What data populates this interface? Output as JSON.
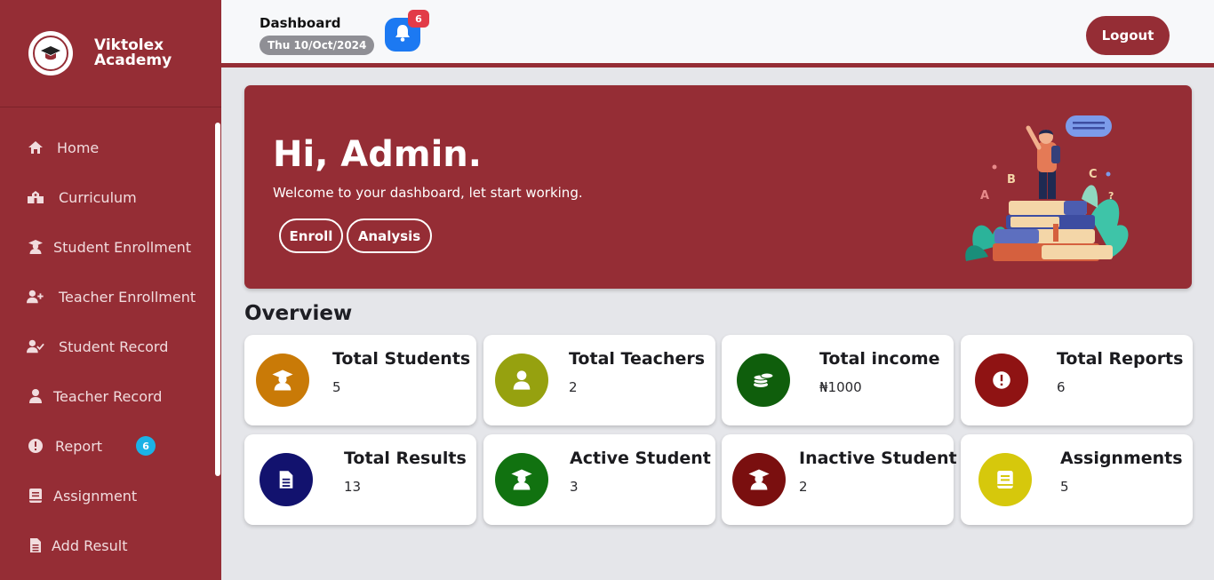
{
  "brand": {
    "line1": "Viktolex",
    "line2": "Academy"
  },
  "sidebar": {
    "items": [
      {
        "label": "Home",
        "icon": "home-icon"
      },
      {
        "label": "Curriculum",
        "icon": "school-icon"
      },
      {
        "label": "Student Enrollment",
        "icon": "graduate-icon"
      },
      {
        "label": "Teacher Enrollment",
        "icon": "user-plus-icon"
      },
      {
        "label": "Student Record",
        "icon": "user-check-icon"
      },
      {
        "label": "Teacher Record",
        "icon": "user-icon"
      },
      {
        "label": "Report",
        "icon": "exclamation-icon",
        "badge": "6"
      },
      {
        "label": "Assignment",
        "icon": "book-icon"
      },
      {
        "label": "Add Result",
        "icon": "file-icon"
      }
    ]
  },
  "header": {
    "title": "Dashboard",
    "date": "Thu 10/Oct/2024",
    "notification_count": "6",
    "logout_label": "Logout"
  },
  "hero": {
    "greeting": "Hi, Admin.",
    "subtitle": "Welcome to your dashboard, let start working.",
    "enroll_label": "Enroll",
    "analysis_label": "Analysis"
  },
  "overview": {
    "title": "Overview",
    "cards": [
      {
        "title": "Total Students",
        "value": "5",
        "color": "#c97a07",
        "icon": "graduate-icon"
      },
      {
        "title": "Total Teachers",
        "value": "2",
        "color": "#96a10f",
        "icon": "user-icon"
      },
      {
        "title": "Total income",
        "value": "₦1000",
        "color": "#0f5e0c",
        "icon": "coins-icon"
      },
      {
        "title": "Total Reports",
        "value": "6",
        "color": "#8f1313",
        "icon": "exclamation-icon"
      },
      {
        "title": "Total Results",
        "value": "13",
        "color": "#12126e",
        "icon": "file-icon"
      },
      {
        "title": "Active Student",
        "value": "3",
        "color": "#117210",
        "icon": "graduate-icon"
      },
      {
        "title": "Inactive Student",
        "value": "2",
        "color": "#7a0f0f",
        "icon": "graduate-icon"
      },
      {
        "title": "Assignments",
        "value": "5",
        "color": "#d6c80c",
        "icon": "book-icon"
      }
    ]
  }
}
